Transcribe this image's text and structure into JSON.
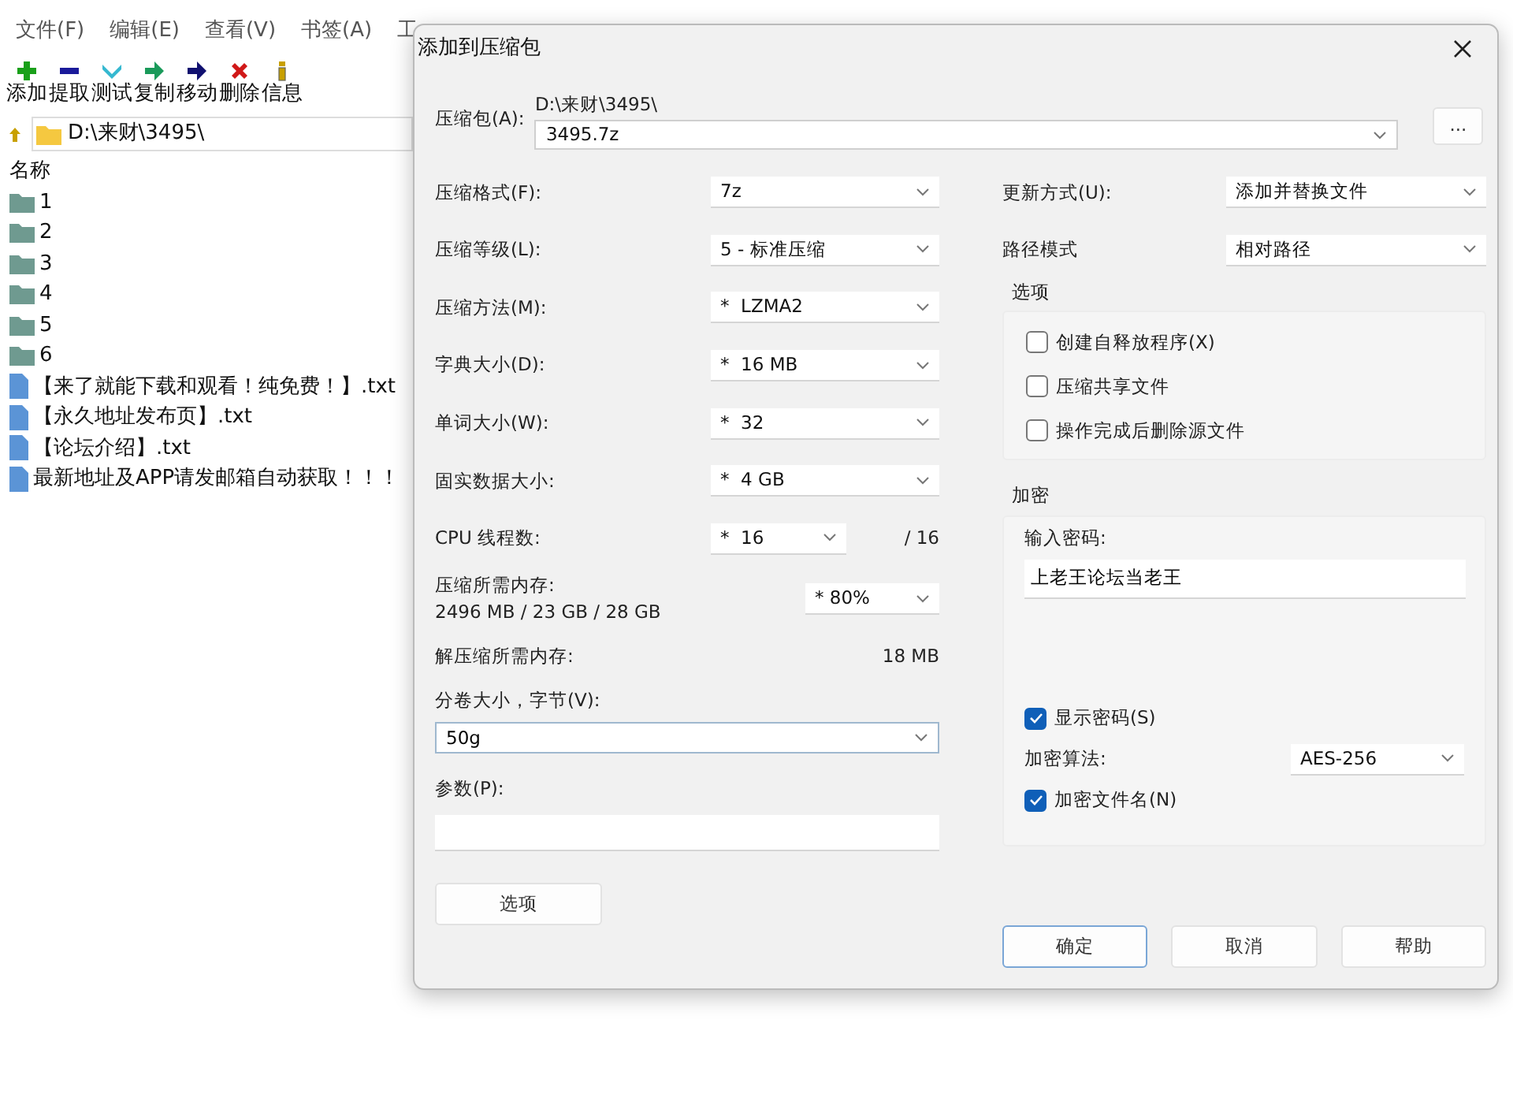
{
  "main_window": {
    "menu": [
      "文件(F)",
      "编辑(E)",
      "查看(V)",
      "书签(A)",
      "工"
    ],
    "toolbar": [
      "添加",
      "提取",
      "测试",
      "复制",
      "移动",
      "删除",
      "信息"
    ],
    "address": "D:\\来财\\3495\\",
    "file_list": {
      "column": "名称",
      "items": [
        {
          "name": "1",
          "kind": "folder"
        },
        {
          "name": "2",
          "kind": "folder"
        },
        {
          "name": "3",
          "kind": "folder"
        },
        {
          "name": "4",
          "kind": "folder"
        },
        {
          "name": "5",
          "kind": "folder"
        },
        {
          "name": "6",
          "kind": "folder"
        },
        {
          "name": "【来了就能下载和观看！纯免费！】.txt",
          "kind": "file"
        },
        {
          "name": "【永久地址发布页】.txt",
          "kind": "file"
        },
        {
          "name": "【论坛介绍】.txt",
          "kind": "file"
        },
        {
          "name": "最新地址及APP请发邮箱自动获取！！！",
          "kind": "file"
        }
      ]
    }
  },
  "dialog": {
    "title": "添加到压缩包",
    "archive": {
      "label": "压缩包(A):",
      "path": "D:\\来财\\3495\\",
      "value": "3495.7z"
    },
    "browse_button": "...",
    "settings": [
      {
        "label": "压缩格式(F):",
        "value": "7z"
      },
      {
        "label": "压缩等级(L):",
        "value": "5 - 标准压缩"
      },
      {
        "label": "压缩方法(M):",
        "value": "*  LZMA2"
      },
      {
        "label": "字典大小(D):",
        "value": "*  16 MB"
      },
      {
        "label": "单词大小(W):",
        "value": "*  32"
      },
      {
        "label": "固实数据大小:",
        "value": "*  4 GB"
      }
    ],
    "cpu": {
      "label": "CPU 线程数:",
      "value": "*  16",
      "max": "/ 16"
    },
    "memory": {
      "label": "压缩所需内存:",
      "value": "2496 MB / 23 GB / 28 GB",
      "usage": "* 80%"
    },
    "decompress_memory": {
      "label": "解压缩所需内存:",
      "value": "18 MB"
    },
    "volume": {
      "label": "分卷大小，字节(V):",
      "value": "50g"
    },
    "parameters": {
      "label": "参数(P):"
    },
    "options_button": "选项",
    "update_mode": {
      "label": "更新方式(U):",
      "value": "添加并替换文件"
    },
    "path_mode": {
      "label": "路径模式",
      "value": "相对路径"
    },
    "options": {
      "title": "选项",
      "checkboxes": [
        {
          "label": "创建自释放程序(X)",
          "checked": false
        },
        {
          "label": "压缩共享文件",
          "checked": false
        },
        {
          "label": "操作完成后删除源文件",
          "checked": false
        }
      ]
    },
    "encryption": {
      "title": "加密",
      "password_label": "输入密码:",
      "password": "上老王论坛当老王",
      "show_password": {
        "label": "显示密码(S)",
        "checked": true
      },
      "method_label": "加密算法:",
      "method": "AES-256",
      "encrypt_names": {
        "label": "加密文件名(N)",
        "checked": true
      }
    },
    "buttons": [
      {
        "label": "确定",
        "default": true
      },
      {
        "label": "取消",
        "default": false
      },
      {
        "label": "帮助",
        "default": false
      }
    ]
  }
}
